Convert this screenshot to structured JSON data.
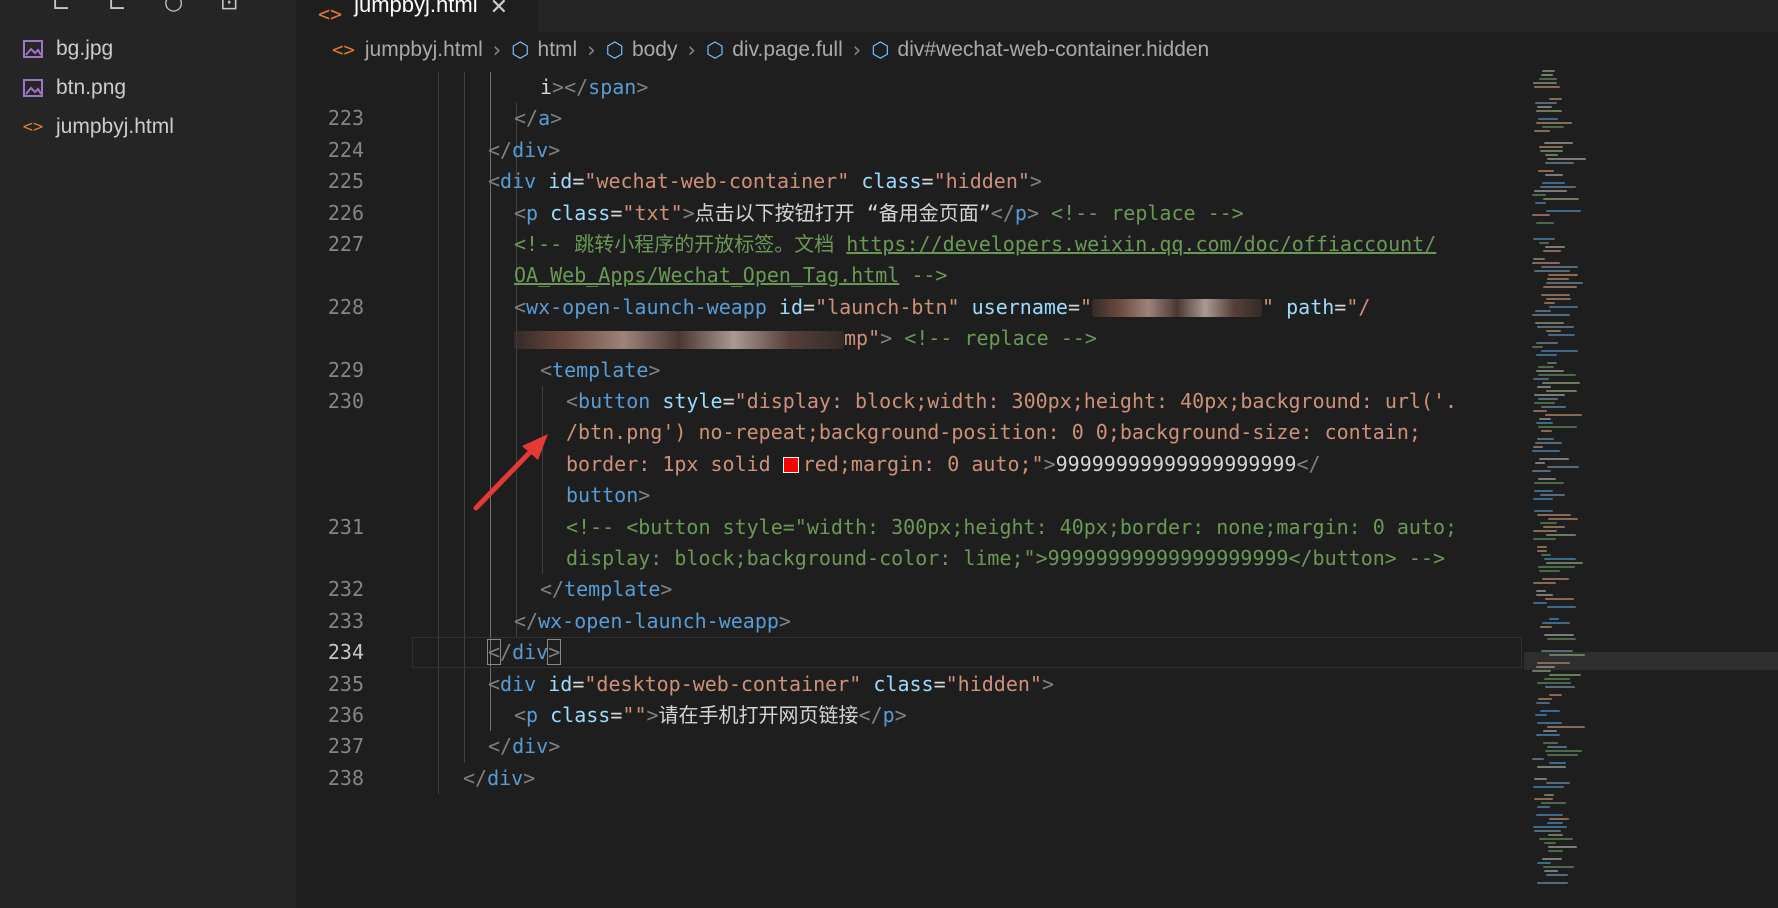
{
  "sidebar": {
    "files": [
      {
        "name": "bg.jpg",
        "icon": "image-file-icon"
      },
      {
        "name": "btn.png",
        "icon": "image-file-icon"
      },
      {
        "name": "jumpbyj.html",
        "icon": "html-file-icon"
      }
    ]
  },
  "tab": {
    "title": "jumpbyj.html"
  },
  "breadcrumb": [
    "jumpbyj.html",
    "html",
    "body",
    "div.page.full",
    "div#wechat-web-container.hidden"
  ],
  "editor": {
    "active_line": "234",
    "lines": [
      {
        "n": "",
        "segs": [
          [
            "text",
            "i"
          ],
          [
            "punc",
            "></"
          ],
          [
            "tag",
            "span"
          ],
          [
            "punc",
            ">"
          ]
        ]
      },
      {
        "n": "223",
        "segs": [
          [
            "punc",
            "</"
          ],
          [
            "tag",
            "a"
          ],
          [
            "punc",
            ">"
          ]
        ]
      },
      {
        "n": "224",
        "segs": [
          [
            "punc",
            "</"
          ],
          [
            "tag",
            "div"
          ],
          [
            "punc",
            ">"
          ]
        ]
      },
      {
        "n": "225",
        "segs": [
          [
            "punc",
            "<"
          ],
          [
            "tag",
            "div"
          ],
          [
            "text",
            " "
          ],
          [
            "attr",
            "id"
          ],
          [
            "text",
            "="
          ],
          [
            "str",
            "\"wechat-web-container\""
          ],
          [
            "text",
            " "
          ],
          [
            "attr",
            "class"
          ],
          [
            "text",
            "="
          ],
          [
            "str",
            "\"hidden\""
          ],
          [
            "punc",
            ">"
          ]
        ]
      },
      {
        "n": "226",
        "segs": [
          [
            "punc",
            "<"
          ],
          [
            "tag",
            "p"
          ],
          [
            "text",
            " "
          ],
          [
            "attr",
            "class"
          ],
          [
            "text",
            "="
          ],
          [
            "str",
            "\"txt\""
          ],
          [
            "punc",
            ">"
          ],
          [
            "text",
            "点击以下按钮打开 “备用金页面”"
          ],
          [
            "punc",
            "</"
          ],
          [
            "tag",
            "p"
          ],
          [
            "punc",
            ">"
          ],
          [
            "text",
            " "
          ],
          [
            "com",
            "<!-- replace -->"
          ]
        ]
      },
      {
        "n": "227",
        "segs": [
          [
            "com",
            "<!-- 跳转小程序的开放标签。文档 "
          ],
          [
            "link",
            "https://developers.weixin.qq.com/doc/offiaccount/"
          ]
        ]
      },
      {
        "n": "",
        "segs": [
          [
            "link",
            "OA_Web_Apps/Wechat_Open_Tag.html"
          ],
          [
            "com",
            " -->"
          ]
        ]
      },
      {
        "n": "228",
        "segs": [
          [
            "punc",
            "<"
          ],
          [
            "tag",
            "wx-open-launch-weapp"
          ],
          [
            "text",
            " "
          ],
          [
            "attr",
            "id"
          ],
          [
            "text",
            "="
          ],
          [
            "str",
            "\"launch-btn\""
          ],
          [
            "text",
            " "
          ],
          [
            "attr",
            "username"
          ],
          [
            "text",
            "="
          ],
          [
            "str",
            "\""
          ],
          [
            "blur",
            "170"
          ],
          [
            "str",
            "\""
          ],
          [
            "text",
            " "
          ],
          [
            "attr",
            "path"
          ],
          [
            "text",
            "="
          ],
          [
            "str",
            "\"/"
          ]
        ]
      },
      {
        "n": "",
        "segs": [
          [
            "blur",
            "330"
          ],
          [
            "str",
            "mp\""
          ],
          [
            "punc",
            ">"
          ],
          [
            "text",
            " "
          ],
          [
            "com",
            "<!-- replace -->"
          ]
        ]
      },
      {
        "n": "229",
        "segs": [
          [
            "punc",
            "<"
          ],
          [
            "tag",
            "template"
          ],
          [
            "punc",
            ">"
          ]
        ]
      },
      {
        "n": "230",
        "segs": [
          [
            "punc",
            "<"
          ],
          [
            "tag",
            "button"
          ],
          [
            "text",
            " "
          ],
          [
            "attr",
            "style"
          ],
          [
            "text",
            "="
          ],
          [
            "str",
            "\"display: block;width: 300px;height: 40px;background: url('."
          ]
        ]
      },
      {
        "n": "",
        "segs": [
          [
            "str",
            "/btn.png') no-repeat;background-position: 0 0;background-size: contain;"
          ]
        ]
      },
      {
        "n": "",
        "segs": [
          [
            "str",
            "border: 1px solid "
          ],
          [
            "swatch",
            ""
          ],
          [
            "str",
            "red;margin: 0 auto;\""
          ],
          [
            "punc",
            ">"
          ],
          [
            "text",
            "99999999999999999999"
          ],
          [
            "punc",
            "</"
          ]
        ]
      },
      {
        "n": "",
        "segs": [
          [
            "tag",
            "button"
          ],
          [
            "punc",
            ">"
          ]
        ]
      },
      {
        "n": "231",
        "segs": [
          [
            "com",
            "<!-- <button style=\"width: 300px;height: 40px;border: none;margin: 0 auto;"
          ]
        ]
      },
      {
        "n": "",
        "segs": [
          [
            "com",
            "display: block;background-color: lime;\">99999999999999999999</button> -->"
          ]
        ]
      },
      {
        "n": "232",
        "segs": [
          [
            "punc",
            "</"
          ],
          [
            "tag",
            "template"
          ],
          [
            "punc",
            ">"
          ]
        ]
      },
      {
        "n": "233",
        "segs": [
          [
            "punc",
            "</"
          ],
          [
            "tag",
            "wx-open-launch-weapp"
          ],
          [
            "punc",
            ">"
          ]
        ]
      },
      {
        "n": "234",
        "segs": [
          [
            "brk",
            "<"
          ],
          [
            "punc",
            "/"
          ],
          [
            "tag",
            "div"
          ],
          [
            "brk",
            ">"
          ]
        ]
      },
      {
        "n": "235",
        "segs": [
          [
            "punc",
            "<"
          ],
          [
            "tag",
            "div"
          ],
          [
            "text",
            " "
          ],
          [
            "attr",
            "id"
          ],
          [
            "text",
            "="
          ],
          [
            "str",
            "\"desktop-web-container\""
          ],
          [
            "text",
            " "
          ],
          [
            "attr",
            "class"
          ],
          [
            "text",
            "="
          ],
          [
            "str",
            "\"hidden\""
          ],
          [
            "punc",
            ">"
          ]
        ]
      },
      {
        "n": "236",
        "segs": [
          [
            "punc",
            "<"
          ],
          [
            "tag",
            "p"
          ],
          [
            "text",
            " "
          ],
          [
            "attr",
            "class"
          ],
          [
            "text",
            "="
          ],
          [
            "str",
            "\"\""
          ],
          [
            "punc",
            ">"
          ],
          [
            "text",
            "请在手机打开网页链接"
          ],
          [
            "punc",
            "</"
          ],
          [
            "tag",
            "p"
          ],
          [
            "punc",
            ">"
          ]
        ]
      },
      {
        "n": "237",
        "segs": [
          [
            "punc",
            "</"
          ],
          [
            "tag",
            "div"
          ],
          [
            "punc",
            ">"
          ]
        ]
      },
      {
        "n": "238",
        "segs": [
          [
            "punc",
            "</"
          ],
          [
            "tag",
            "div"
          ],
          [
            "punc",
            ">"
          ]
        ]
      }
    ]
  },
  "colors": {
    "arrow": "#e53935",
    "swatch": "#ff0000"
  }
}
